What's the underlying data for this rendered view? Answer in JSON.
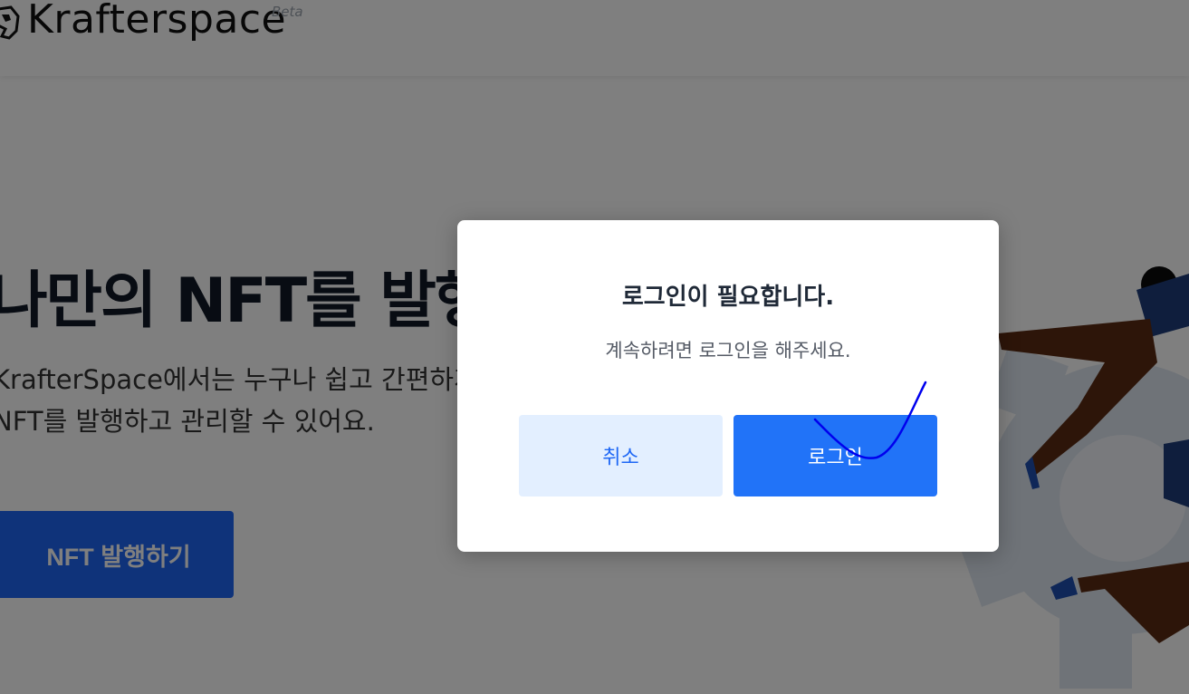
{
  "header": {
    "logo_text": "Krafterspace",
    "beta_label": "Beta",
    "logo_icon": "horse-head-icon"
  },
  "hero": {
    "title": "나만의 NFT를 발행",
    "description_line1": "KrafterSpace에서는 누구나 쉽고 간편하게",
    "description_line2": "NFT를 발행하고 관리할 수 있어요.",
    "cta_label": "NFT 발행하기"
  },
  "modal": {
    "title": "로그인이 필요합니다.",
    "message": "계속하려면 로그인을 해주세요.",
    "cancel_label": "취소",
    "login_label": "로그인"
  },
  "colors": {
    "primary": "#2173f8",
    "cancel_bg": "#e3efff",
    "overlay": "rgba(0,0,0,0.5)",
    "annotation_stroke": "#0000ee"
  }
}
